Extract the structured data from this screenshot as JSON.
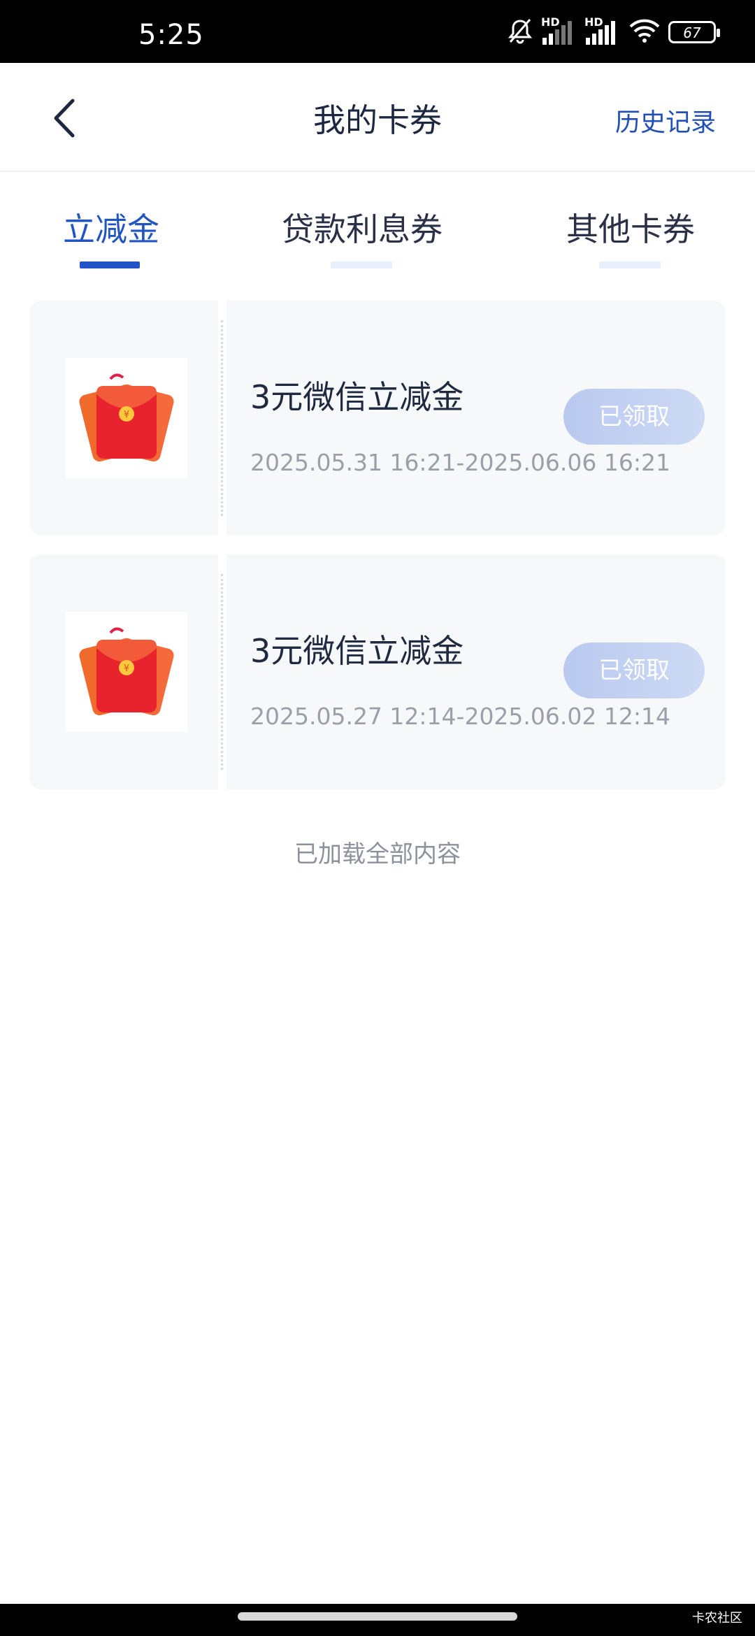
{
  "status_bar": {
    "time": "5:25",
    "battery": "67",
    "icons": [
      "bell-off-icon",
      "hd-signal-icon",
      "hd-signal-icon",
      "wifi-icon",
      "battery-icon"
    ]
  },
  "header": {
    "title": "我的卡券",
    "history_label": "历史记录",
    "back_icon": "chevron-left-icon"
  },
  "tabs": [
    {
      "label": "立减金",
      "active": true
    },
    {
      "label": "贷款利息券",
      "active": false
    },
    {
      "label": "其他卡券",
      "active": false
    }
  ],
  "coupons": [
    {
      "title": "3元微信立减金",
      "dates": "2025.05.31 16:21-2025.06.06 16:21",
      "button": "已领取",
      "icon": "red-envelope-icon"
    },
    {
      "title": "3元微信立减金",
      "dates": "2025.05.27 12:14-2025.06.02 12:14",
      "button": "已领取",
      "icon": "red-envelope-icon"
    }
  ],
  "footer": {
    "end_text": "已加载全部内容"
  },
  "watermark": "卡农社区",
  "colors": {
    "accent": "#2153c6",
    "button": "#c3d1f2",
    "card_bg": "#f7f8fa"
  }
}
